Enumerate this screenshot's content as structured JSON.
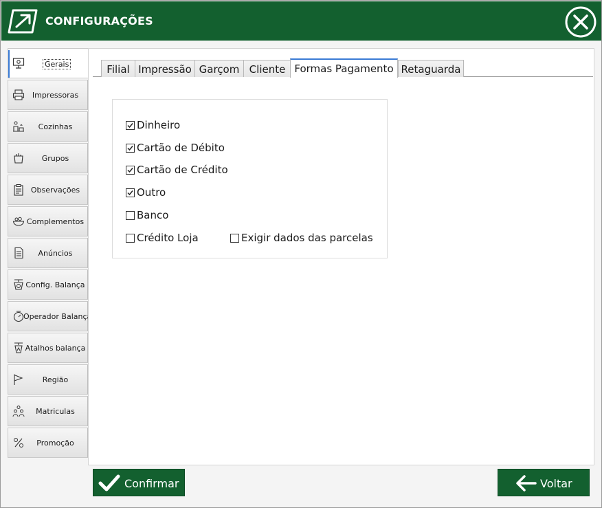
{
  "window": {
    "title": "CONFIGURAÇÕES",
    "accent": "#13602f",
    "tab_accent": "#3a7bd5"
  },
  "sidebar": {
    "items": [
      {
        "label": "Gerais",
        "icon": "monitor-settings-icon",
        "active": true
      },
      {
        "label": "Impressoras",
        "icon": "printer-icon"
      },
      {
        "label": "Cozinhas",
        "icon": "kitchen-icon"
      },
      {
        "label": "Grupos",
        "icon": "grocery-bag-icon"
      },
      {
        "label": "Observações",
        "icon": "clipboard-icon"
      },
      {
        "label": "Complementos",
        "icon": "salad-bowl-icon"
      },
      {
        "label": "Anúncios",
        "icon": "document-icon"
      },
      {
        "label": "Config. Balança",
        "icon": "scale-icon"
      },
      {
        "label": "Operador  Balança",
        "icon": "scale-dial-icon"
      },
      {
        "label": "Atalhos balança",
        "icon": "scale-shortcut-icon"
      },
      {
        "label": "Região",
        "icon": "flag-icon"
      },
      {
        "label": "Matriculas",
        "icon": "people-icon"
      },
      {
        "label": "Promoção",
        "icon": "promotion-icon"
      }
    ]
  },
  "tabs": [
    {
      "label": "Filial"
    },
    {
      "label": "Impressão"
    },
    {
      "label": "Garçom"
    },
    {
      "label": "Cliente"
    },
    {
      "label": "Formas Pagamento",
      "active": true
    },
    {
      "label": "Retaguarda"
    }
  ],
  "payment_methods": {
    "dinheiro": {
      "label": "Dinheiro",
      "checked": true
    },
    "debito": {
      "label": "Cartão de Débito",
      "checked": true
    },
    "credito": {
      "label": "Cartão de Crédito",
      "checked": true
    },
    "outro": {
      "label": "Outro",
      "checked": true
    },
    "banco": {
      "label": "Banco",
      "checked": false
    },
    "credito_loja": {
      "label": "Crédito Loja",
      "checked": false
    },
    "exigir_parcelas": {
      "label": "Exigir dados das parcelas",
      "checked": false
    }
  },
  "buttons": {
    "confirm": "Confirmar",
    "back": "Voltar"
  }
}
